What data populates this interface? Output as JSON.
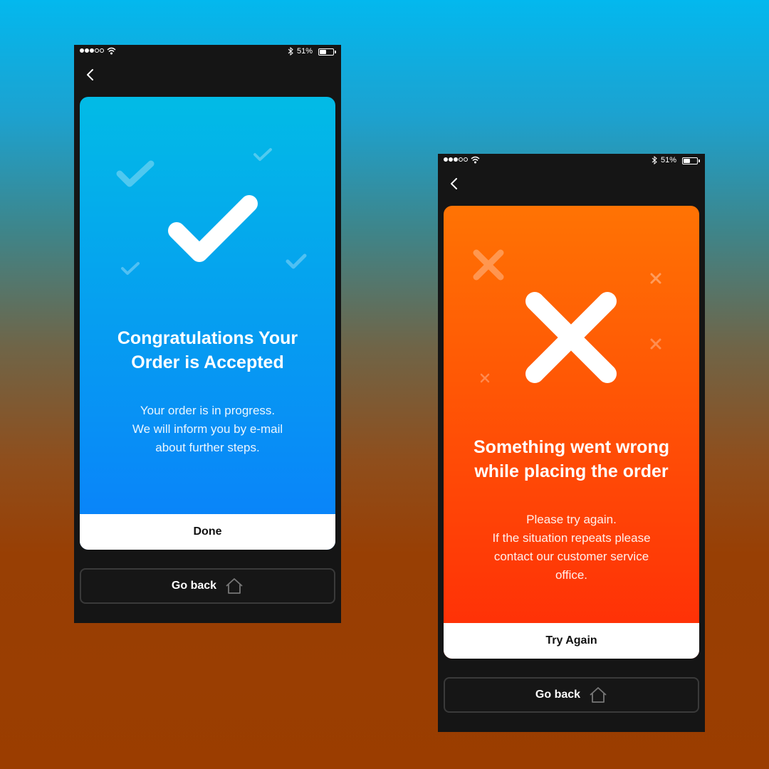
{
  "screens": [
    {
      "status": {
        "battery_percent": "51%",
        "battery_level": 0.51
      },
      "card": {
        "variant": "success",
        "icon": "checkmark-icon",
        "gradient": [
          "#02bbe6",
          "#0a80fb"
        ],
        "title_line1": "Congratulations Your",
        "title_line2": "Order is Accepted",
        "message": [
          "Your order is in progress.",
          "We will inform you by e-mail",
          "about further steps."
        ],
        "action_label": "Done"
      },
      "go_back_label": "Go back"
    },
    {
      "status": {
        "battery_percent": "51%",
        "battery_level": 0.51
      },
      "card": {
        "variant": "error",
        "icon": "close-x-icon",
        "gradient": [
          "#ff7304",
          "#ff2c07"
        ],
        "title_line1": "Something went wrong",
        "title_line2": "while placing the order",
        "message": [
          "Please try again.",
          "If the situation repeats please",
          "contact our customer service",
          "office."
        ],
        "action_label": "Try Again"
      },
      "go_back_label": "Go back"
    }
  ]
}
